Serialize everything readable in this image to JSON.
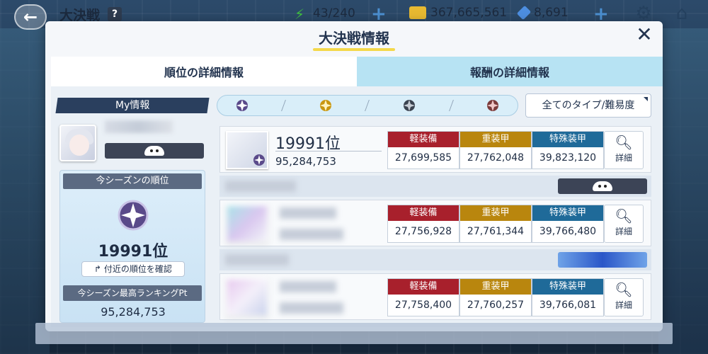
{
  "topbar": {
    "title": "大決戦",
    "help": "?",
    "ap": "43/240",
    "credits": "367,665,561",
    "gems": "8,691"
  },
  "modal": {
    "title": "大決戦情報",
    "tabs": [
      "順位の詳細情報",
      "報酬の詳細情報"
    ]
  },
  "my_info": {
    "label": "My情報",
    "season_rank_label": "今シーズンの順位",
    "season_rank": "19991位",
    "nearby_button": "付近の順位を確認",
    "best_label": "今シーズン最高ランキングPt",
    "best_value": "95,284,753"
  },
  "filter": {
    "dropdown": "全てのタイプ/難易度"
  },
  "armor_labels": {
    "light": "軽装備",
    "heavy": "重装甲",
    "special": "特殊装甲"
  },
  "entries": [
    {
      "rank": "19991位",
      "score": "95,284,753",
      "light": "27,699,585",
      "heavy": "27,762,048",
      "special": "39,823,120",
      "detail": "詳細"
    },
    {
      "rank": "",
      "score": "",
      "light": "27,756,928",
      "heavy": "27,761,344",
      "special": "39,766,480",
      "detail": "詳細"
    },
    {
      "rank": "",
      "score": "",
      "light": "27,758,400",
      "heavy": "27,760,257",
      "special": "39,766,081",
      "detail": "詳細"
    }
  ],
  "icons": {
    "back": "back-arrow-icon",
    "ap": "lightning-icon",
    "credits": "credit-card-icon",
    "gems": "gem-icon",
    "settings": "gear-icon",
    "home": "home-icon",
    "close": "close-icon",
    "search": "magnifier-icon"
  },
  "colors": {
    "light_armor": "#a8202c",
    "heavy_armor": "#b9860e",
    "special_armor": "#1f6a99",
    "active_tab": "#ffffff",
    "inactive_tab": "#b7e3f3"
  }
}
